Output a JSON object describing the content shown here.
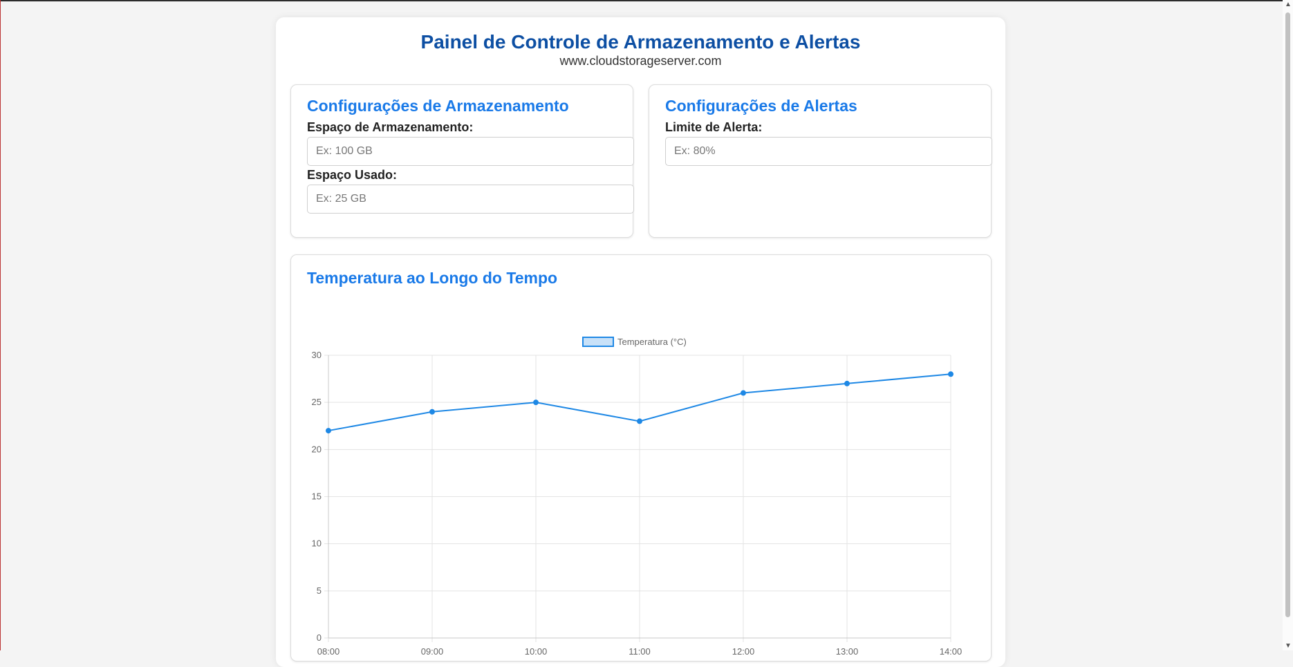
{
  "header": {
    "title": "Painel de Controle de Armazenamento e Alertas",
    "subtitle": "www.cloudstorageserver.com"
  },
  "storage": {
    "title": "Configurações de Armazenamento",
    "space_label": "Espaço de Armazenamento:",
    "space_placeholder": "Ex: 100 GB",
    "used_label": "Espaço Usado:",
    "used_placeholder": "Ex: 25 GB"
  },
  "alerts": {
    "title": "Configurações de Alertas",
    "limit_label": "Limite de Alerta:",
    "limit_placeholder": "Ex: 80%"
  },
  "chart_section": {
    "title": "Temperatura ao Longo do Tempo"
  },
  "colors": {
    "accent": "#1a7ae8",
    "title": "#0d4fa3",
    "line": "#1e88e5"
  },
  "scrollbar": {
    "up_icon": "chevron-up-icon",
    "down_icon": "chevron-down-icon"
  },
  "chart_data": {
    "type": "line",
    "title": "",
    "xlabel": "",
    "ylabel": "",
    "categories": [
      "08:00",
      "09:00",
      "10:00",
      "11:00",
      "12:00",
      "13:00",
      "14:00"
    ],
    "series": [
      {
        "name": "Temperatura (°C)",
        "values": [
          22,
          24,
          25,
          23,
          26,
          27,
          28
        ]
      }
    ],
    "ylim": [
      0,
      30
    ],
    "yticks": [
      0,
      5,
      10,
      15,
      20,
      25,
      30
    ],
    "grid": true,
    "legend": "top-center"
  }
}
